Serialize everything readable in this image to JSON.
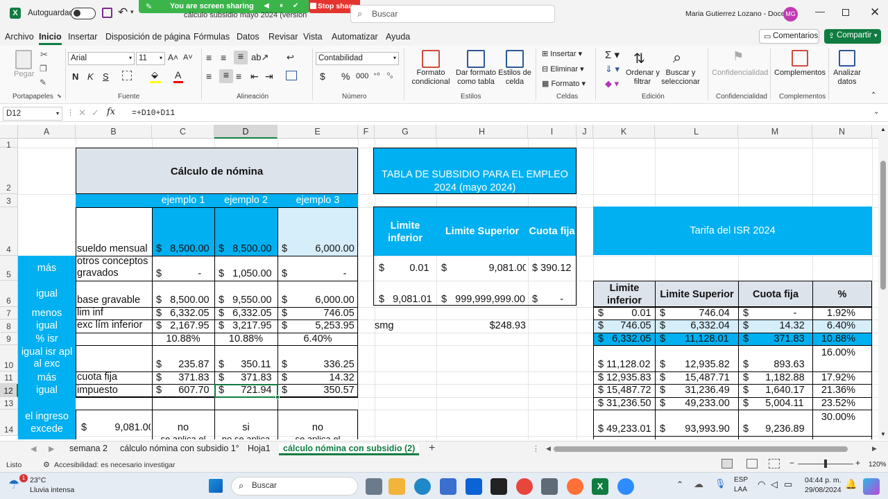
{
  "titlebar": {
    "autosave": "Autoguardado",
    "doc_title": "cálculo subsidio mayo 2024 (version 1)",
    "search_placeholder": "Buscar",
    "user": "Maria Gutierrez Lozano - Docente",
    "avatar": "MG",
    "sharing": "You are screen sharing",
    "stop_share": "Stop share"
  },
  "menu": {
    "items": [
      "Archivo",
      "Inicio",
      "Insertar",
      "Disposición de página",
      "Fórmulas",
      "Datos",
      "Revisar",
      "Vista",
      "Automatizar",
      "Ayuda"
    ],
    "comments": "Comentarios",
    "share": "Compartir"
  },
  "ribbon": {
    "paste": "Pegar",
    "font_name": "Arial",
    "font_size": "11",
    "number_format": "Contabilidad",
    "groups": {
      "clipboard": "Portapapeles",
      "font": "Fuente",
      "alignment": "Alineación",
      "number": "Número",
      "styles": "Estilos",
      "cells": "Celdas",
      "editing": "Edición",
      "confidentiality": "Confidencialidad",
      "addins": "Complementos"
    },
    "cond_format": [
      "Formato",
      "condicional"
    ],
    "format_table": [
      "Dar formato",
      "como tabla"
    ],
    "cell_styles": [
      "Estilos de",
      "celda"
    ],
    "insert": "Insertar",
    "delete": "Eliminar",
    "format": "Formato",
    "sort_filter": [
      "Ordenar y",
      "filtrar"
    ],
    "find_select": [
      "Buscar y",
      "seleccionar"
    ],
    "confidentiality": "Confidencialidad",
    "addins": "Complementos",
    "analyze": [
      "Analizar",
      "datos"
    ]
  },
  "formula_bar": {
    "name_box": "D12",
    "formula": "=+D10+D11"
  },
  "columns": [
    "A",
    "B",
    "C",
    "D",
    "E",
    "F",
    "G",
    "H",
    "I",
    "J",
    "K",
    "L",
    "M",
    "N"
  ],
  "rows": [
    "1",
    "2",
    "3",
    "4",
    "5",
    "6",
    "7",
    "8",
    "9",
    "10",
    "11",
    "12",
    "13",
    "14"
  ],
  "sheet": {
    "nomina": {
      "title": "Cálculo de nómina",
      "examples": [
        "ejemplo 1",
        "ejemplo 2",
        "ejemplo 3"
      ],
      "lines": [
        {
          "a": "",
          "b": "sueldo mensual",
          "c": "$   8,500.00",
          "d": "$   8,500.00",
          "e": "$          6,000.00"
        },
        {
          "a": "más",
          "b": "otros conceptos gravados",
          "c": "$             -",
          "d": "$   1,050.00",
          "e": "$                    -"
        },
        {
          "a": "igual",
          "b": "base gravable",
          "c": "$   8,500.00",
          "d": "$   9,550.00",
          "e": "$          6,000.00"
        },
        {
          "a": "menos",
          "b": "lim inf",
          "c": "$   6,332.05",
          "d": "$   6,332.05",
          "e": "$             746.05"
        },
        {
          "a": "igual",
          "b": "exc lím inferior",
          "c": "$   2,167.95",
          "d": "$   3,217.95",
          "e": "$          5,253.95"
        },
        {
          "a": "% isr",
          "b": "",
          "c": "10.88%",
          "d": "10.88%",
          "e": "6.40%"
        },
        {
          "a": "igual isr apl al exc",
          "b": "",
          "c": "$      235.87",
          "d": "$      350.11",
          "e": "$             336.25"
        },
        {
          "a": "más",
          "b": "cuota fija",
          "c": "$      371.83",
          "d": "$      371.83",
          "e": "$               14.32"
        },
        {
          "a": "igual",
          "b": "impuesto",
          "c": "$      607.70",
          "d": "$      721.94",
          "e": "$             350.57"
        }
      ],
      "row14": {
        "a": "el ingreso excede",
        "b": "$          9,081.00",
        "c": "no",
        "d": "si",
        "e": "no"
      },
      "row15_partial": [
        "se aplica el",
        "no se aplica",
        "se aplica el"
      ]
    },
    "subsidio": {
      "title": "TABLA DE SUBSIDIO PARA EL EMPLEO 2024 (mayo 2024)",
      "headers": [
        "Limite inferior",
        "Limite Superior",
        "Cuota fija"
      ],
      "rows": [
        {
          "inf": "$         0.01",
          "sup": "$               9,081.00",
          "cuota": "$ 390.12"
        },
        {
          "inf": "$   9,081.01",
          "sup": "$   999,999,999.00",
          "cuota": "$        -"
        }
      ],
      "smg_label": "smg",
      "smg_value": "$248.93"
    },
    "isr": {
      "title": "Tarifa del ISR 2024",
      "headers": [
        "Limite inferior",
        "Limite Superior",
        "Cuota fija",
        "%"
      ],
      "rows": [
        {
          "inf": "$          0.01",
          "sup": "$            746.04",
          "cuota": "$                -",
          "pct": "1.92%"
        },
        {
          "inf": "$      746.05",
          "sup": "$         6,332.04",
          "cuota": "$           14.32",
          "pct": "6.40%"
        },
        {
          "inf": "$   6,332.05",
          "sup": "$       11,128.01",
          "cuota": "$         371.83",
          "pct": "10.88%"
        },
        {
          "inf": "$ 11,128.02",
          "sup": "$       12,935.82",
          "cuota": "$         893.63",
          "pct": "16.00%"
        },
        {
          "inf": "$ 12,935.83",
          "sup": "$       15,487.71",
          "cuota": "$      1,182.88",
          "pct": "17.92%"
        },
        {
          "inf": "$ 15,487.72",
          "sup": "$       31,236.49",
          "cuota": "$      1,640.17",
          "pct": "21.36%"
        },
        {
          "inf": "$ 31,236.50",
          "sup": "$       49,233.00",
          "cuota": "$      5,004.11",
          "pct": "23.52%"
        },
        {
          "inf": "$ 49,233.01",
          "sup": "$       93,993.90",
          "cuota": "$      9,236.89",
          "pct": "30.00%"
        }
      ]
    }
  },
  "tabs": {
    "items": [
      "semana 2",
      "cálculo nómina con subsidio 1°",
      "Hoja1",
      "cálculo nómina con subsidio (2)"
    ],
    "add": "+"
  },
  "status": {
    "ready": "Listo",
    "accessibility": "Accesibilidad: es necesario investigar",
    "zoom": "120%"
  },
  "taskbar": {
    "temp": "23°C",
    "weather": "Lluvia intensa",
    "search": "Buscar",
    "lang1": "ESP",
    "lang2": "LAA",
    "time": "04:44 p. m.",
    "date": "29/08/2024",
    "badge": "1"
  },
  "colors": {
    "accent": "#107c41",
    "cyan": "#00b0f0",
    "light_blue": "#d6eefa",
    "gray_blue": "#dde3eb",
    "share_green": "#3bb54a",
    "stop_red": "#e5342f"
  }
}
